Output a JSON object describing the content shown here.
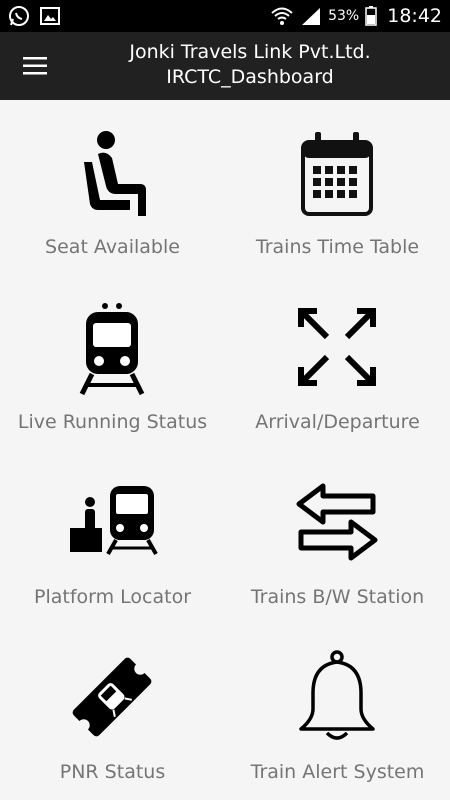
{
  "status_bar": {
    "battery_percent": "53%",
    "time": "18:42",
    "icons": [
      "whatsapp-icon",
      "gallery-icon",
      "wifi-icon",
      "signal-icon",
      "battery-icon"
    ]
  },
  "app_bar": {
    "title_line1": "Jonki Travels Link Pvt.Ltd.",
    "title_line2": "IRCTC_Dashboard",
    "menu_icon": "hamburger-menu-icon"
  },
  "tiles": [
    {
      "label": "Seat Available",
      "icon": "seat-icon"
    },
    {
      "label": "Trains Time Table",
      "icon": "calendar-icon"
    },
    {
      "label": "Live Running Status",
      "icon": "train-icon"
    },
    {
      "label": "Arrival/Departure",
      "icon": "expand-arrows-icon"
    },
    {
      "label": "Platform Locator",
      "icon": "platform-train-icon"
    },
    {
      "label": "Trains B/W Station",
      "icon": "swap-arrows-icon"
    },
    {
      "label": "PNR Status",
      "icon": "ticket-icon"
    },
    {
      "label": "Train Alert System",
      "icon": "bell-icon"
    }
  ]
}
